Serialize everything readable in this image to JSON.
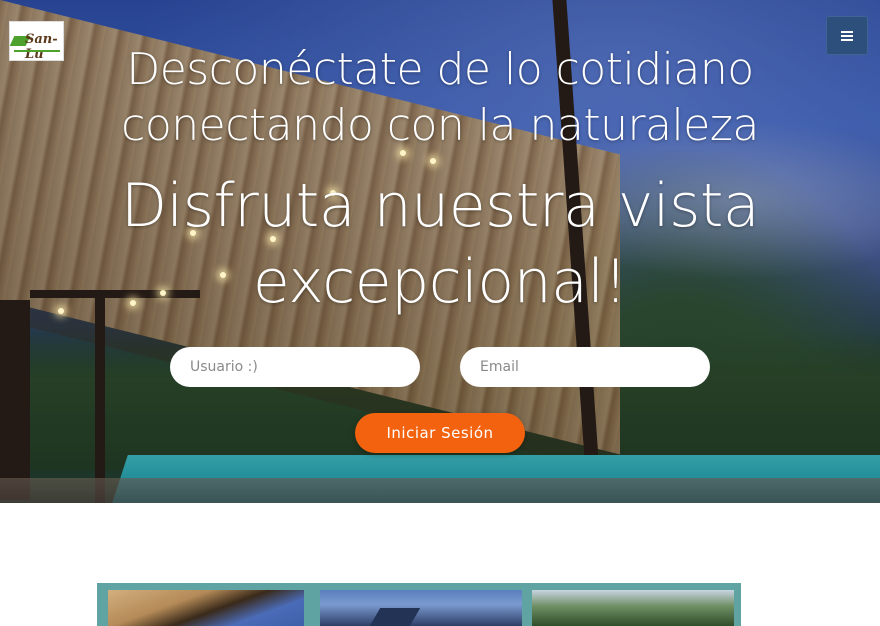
{
  "logo": {
    "text": "San-Lu"
  },
  "header": {
    "menu_icon": "hamburger-icon",
    "menu_color": "#2c4f7c"
  },
  "hero": {
    "subtitle_line1": "Desconéctate de lo cotidiano",
    "subtitle_line2": "conectando con la naturaleza",
    "title_line1": "Disfruta nuestra vista",
    "title_line2": "excepcional!"
  },
  "form": {
    "username_placeholder": "Usuario :)",
    "email_placeholder": "Email",
    "submit_label": "Iniciar Sesión",
    "submit_color": "#f2620f"
  },
  "gallery": {
    "frame_color": "#5fa3a3",
    "thumbnails": [
      "pergola-pool-photo",
      "cabin-dusk-photo",
      "forest-photo"
    ]
  }
}
